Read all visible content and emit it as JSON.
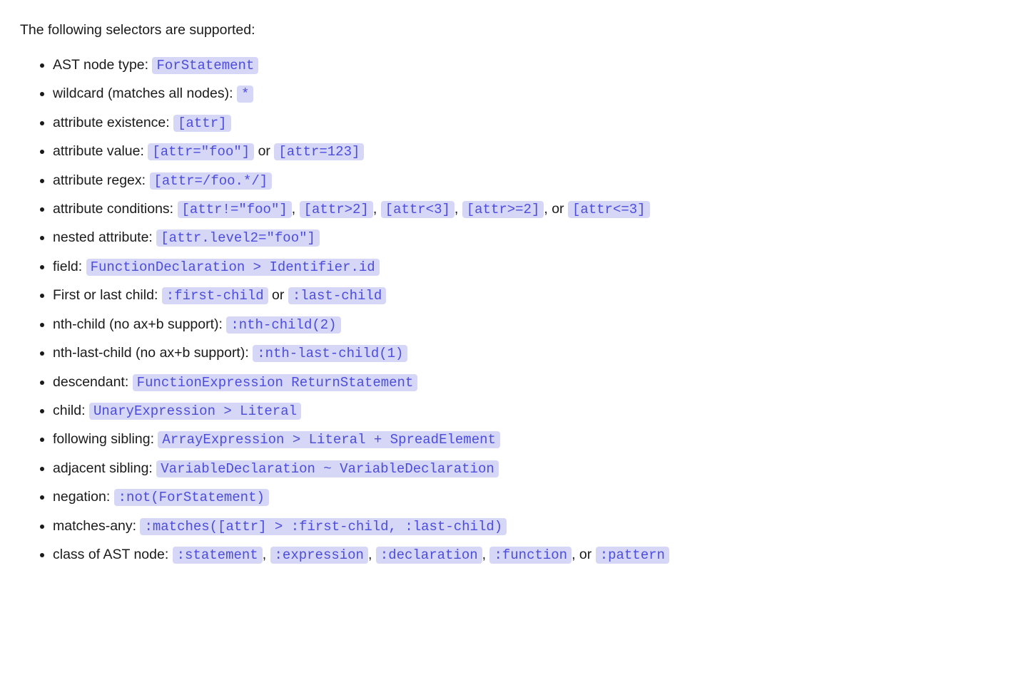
{
  "intro": "The following selectors are supported:",
  "items": [
    {
      "label": "AST node type: ",
      "codes": [
        "ForStatement"
      ],
      "seps": []
    },
    {
      "label": "wildcard (matches all nodes): ",
      "codes": [
        "*"
      ],
      "seps": []
    },
    {
      "label": "attribute existence: ",
      "codes": [
        "[attr]"
      ],
      "seps": []
    },
    {
      "label": "attribute value: ",
      "codes": [
        "[attr=\"foo\"]",
        "[attr=123]"
      ],
      "seps": [
        " or "
      ]
    },
    {
      "label": "attribute regex: ",
      "codes": [
        "[attr=/foo.*/]"
      ],
      "seps": []
    },
    {
      "label": "attribute conditions: ",
      "codes": [
        "[attr!=\"foo\"]",
        "[attr>2]",
        "[attr<3]",
        "[attr>=2]",
        "[attr<=3]"
      ],
      "seps": [
        ", ",
        ", ",
        ", ",
        ", or "
      ]
    },
    {
      "label": "nested attribute: ",
      "codes": [
        "[attr.level2=\"foo\"]"
      ],
      "seps": []
    },
    {
      "label": "field: ",
      "codes": [
        "FunctionDeclaration > Identifier.id"
      ],
      "seps": []
    },
    {
      "label": "First or last child: ",
      "codes": [
        ":first-child",
        ":last-child"
      ],
      "seps": [
        " or "
      ]
    },
    {
      "label": "nth-child (no ax+b support): ",
      "codes": [
        ":nth-child(2)"
      ],
      "seps": []
    },
    {
      "label": "nth-last-child (no ax+b support): ",
      "codes": [
        ":nth-last-child(1)"
      ],
      "seps": []
    },
    {
      "label": "descendant: ",
      "codes": [
        "FunctionExpression ReturnStatement"
      ],
      "seps": []
    },
    {
      "label": "child: ",
      "codes": [
        "UnaryExpression > Literal"
      ],
      "seps": []
    },
    {
      "label": "following sibling: ",
      "codes": [
        "ArrayExpression > Literal + SpreadElement"
      ],
      "seps": []
    },
    {
      "label": "adjacent sibling: ",
      "codes": [
        "VariableDeclaration ~ VariableDeclaration"
      ],
      "seps": []
    },
    {
      "label": "negation: ",
      "codes": [
        ":not(ForStatement)"
      ],
      "seps": []
    },
    {
      "label": "matches-any: ",
      "codes": [
        ":matches([attr] > :first-child, :last-child)"
      ],
      "seps": []
    },
    {
      "label": "class of AST node: ",
      "codes": [
        ":statement",
        ":expression",
        ":declaration",
        ":function",
        ":pattern"
      ],
      "seps": [
        ", ",
        ", ",
        ", ",
        ", or "
      ]
    }
  ]
}
